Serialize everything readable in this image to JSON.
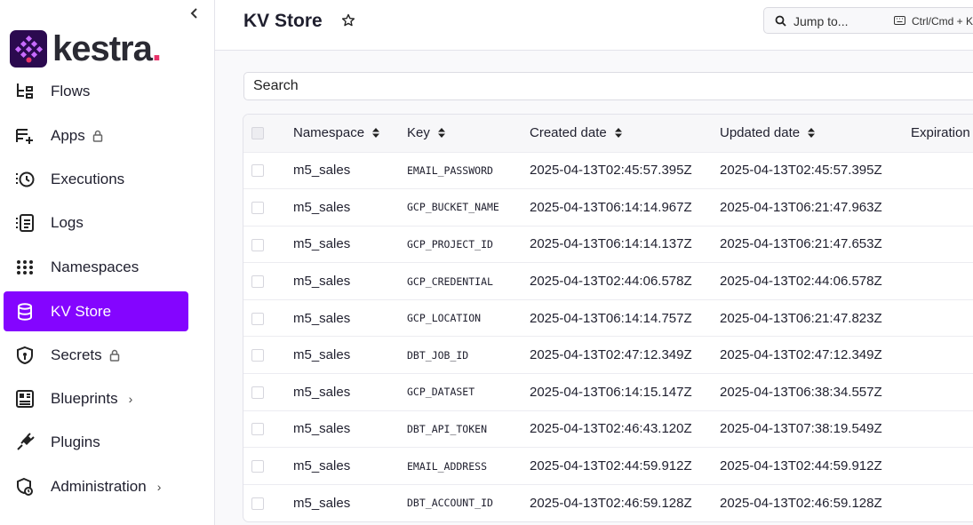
{
  "sidebar": {
    "collapse_glyph": "‹",
    "logo_text": "kestra",
    "logo_dot": ".",
    "items": [
      {
        "label": "Flows",
        "icon": "flows-icon"
      },
      {
        "label": "Apps",
        "icon": "apps-icon",
        "locked": true
      },
      {
        "label": "Executions",
        "icon": "executions-icon"
      },
      {
        "label": "Logs",
        "icon": "logs-icon"
      },
      {
        "label": "Namespaces",
        "icon": "namespaces-icon"
      },
      {
        "label": "KV Store",
        "icon": "database-icon",
        "active": true
      },
      {
        "label": "Secrets",
        "icon": "shield-icon",
        "locked": true
      },
      {
        "label": "Blueprints",
        "icon": "blueprints-icon",
        "has_children": true
      },
      {
        "label": "Plugins",
        "icon": "plug-icon"
      },
      {
        "label": "Administration",
        "icon": "admin-icon",
        "has_children": true
      }
    ],
    "chevron_glyph": "›"
  },
  "header": {
    "title": "KV Store",
    "jump_label": "Jump to...",
    "shortcut": "Ctrl/Cmd + K"
  },
  "search": {
    "placeholder": "Search"
  },
  "table": {
    "columns": [
      "Namespace",
      "Key",
      "Created date",
      "Updated date",
      "Expiration date"
    ],
    "rows": [
      [
        "m5_sales",
        "EMAIL_PASSWORD",
        "2025-04-13T02:45:57.395Z",
        "2025-04-13T02:45:57.395Z"
      ],
      [
        "m5_sales",
        "GCP_BUCKET_NAME",
        "2025-04-13T06:14:14.967Z",
        "2025-04-13T06:21:47.963Z"
      ],
      [
        "m5_sales",
        "GCP_PROJECT_ID",
        "2025-04-13T06:14:14.137Z",
        "2025-04-13T06:21:47.653Z"
      ],
      [
        "m5_sales",
        "GCP_CREDENTIAL",
        "2025-04-13T02:44:06.578Z",
        "2025-04-13T02:44:06.578Z"
      ],
      [
        "m5_sales",
        "GCP_LOCATION",
        "2025-04-13T06:14:14.757Z",
        "2025-04-13T06:21:47.823Z"
      ],
      [
        "m5_sales",
        "DBT_JOB_ID",
        "2025-04-13T02:47:12.349Z",
        "2025-04-13T02:47:12.349Z"
      ],
      [
        "m5_sales",
        "GCP_DATASET",
        "2025-04-13T06:14:15.147Z",
        "2025-04-13T06:38:34.557Z"
      ],
      [
        "m5_sales",
        "DBT_API_TOKEN",
        "2025-04-13T02:46:43.120Z",
        "2025-04-13T07:38:19.549Z"
      ],
      [
        "m5_sales",
        "EMAIL_ADDRESS",
        "2025-04-13T02:44:59.912Z",
        "2025-04-13T02:44:59.912Z"
      ],
      [
        "m5_sales",
        "DBT_ACCOUNT_ID",
        "2025-04-13T02:46:59.128Z",
        "2025-04-13T02:46:59.128Z"
      ]
    ]
  },
  "colors": {
    "accent": "#8405ff",
    "brand_dot": "#e8336a"
  }
}
